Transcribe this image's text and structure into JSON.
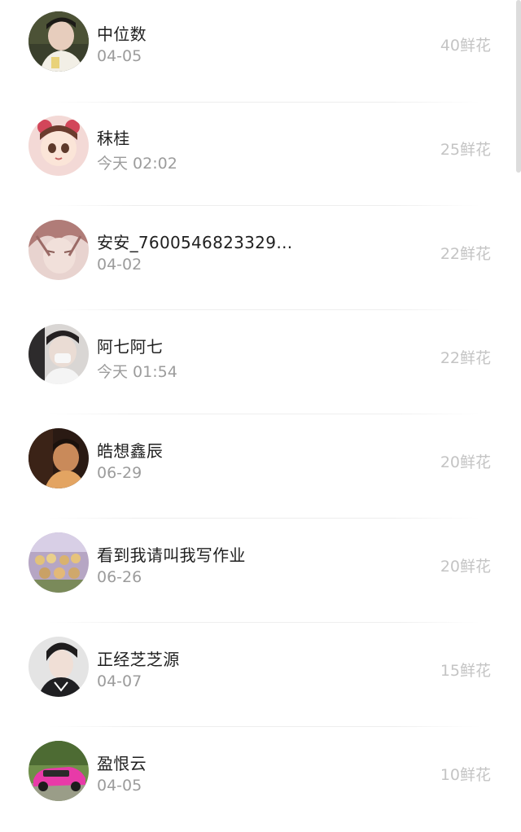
{
  "list": {
    "items": [
      {
        "name": "中位数",
        "date": "04-05",
        "flowers": "40鲜花"
      },
      {
        "name": "秣桂",
        "date": "今天 02:02",
        "flowers": "25鲜花"
      },
      {
        "name": "安安_7600546823329…",
        "date": "04-02",
        "flowers": "22鲜花"
      },
      {
        "name": "阿七阿七",
        "date": "今天 01:54",
        "flowers": "22鲜花"
      },
      {
        "name": "皓想鑫辰",
        "date": "06-29",
        "flowers": "20鲜花"
      },
      {
        "name": "看到我请叫我写作业",
        "date": "06-26",
        "flowers": "20鲜花"
      },
      {
        "name": "正经芝芝源",
        "date": "04-07",
        "flowers": "15鲜花"
      },
      {
        "name": "盈恨云",
        "date": "04-05",
        "flowers": "10鲜花"
      }
    ]
  },
  "colors": {
    "name_text": "#1f1f1f",
    "date_text": "#9c9c9c",
    "flowers_text": "#c4c4c4",
    "divider": "#eeeeee",
    "background": "#ffffff"
  }
}
